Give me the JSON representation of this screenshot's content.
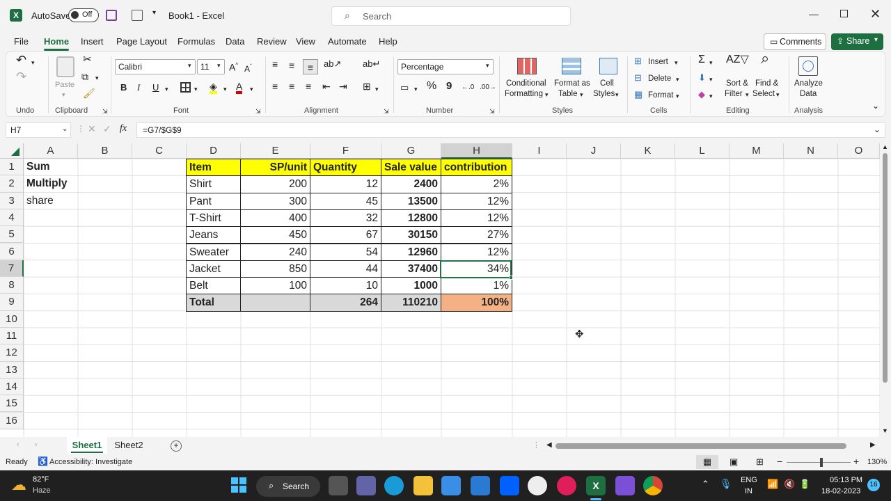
{
  "titlebar": {
    "autosave_label": "AutoSave",
    "autosave_state": "Off",
    "doc_title": "Book1  -  Excel",
    "search_placeholder": "Search"
  },
  "menu": {
    "tabs": [
      "File",
      "Home",
      "Insert",
      "Page Layout",
      "Formulas",
      "Data",
      "Review",
      "View",
      "Automate",
      "Help"
    ],
    "active_tab": "Home",
    "comments_label": "Comments",
    "share_label": "Share"
  },
  "ribbon": {
    "groups": {
      "undo": "Undo",
      "clipboard": "Clipboard",
      "font": "Font",
      "alignment": "Alignment",
      "number": "Number",
      "styles": "Styles",
      "cells": "Cells",
      "editing": "Editing",
      "analysis": "Analysis"
    },
    "paste_label": "Paste",
    "font_name": "Calibri",
    "font_size": "11",
    "number_format": "Percentage",
    "conditional_formatting": [
      "Conditional",
      "Formatting"
    ],
    "format_as_table": [
      "Format as",
      "Table"
    ],
    "cell_styles": [
      "Cell",
      "Styles"
    ],
    "insert_label": "Insert",
    "delete_label": "Delete",
    "format_label": "Format",
    "sort_filter": [
      "Sort &",
      "Filter"
    ],
    "find_select": [
      "Find &",
      "Select"
    ],
    "analyze_data": [
      "Analyze",
      "Data"
    ],
    "bold": "B",
    "italic": "I",
    "underline": "U",
    "percent": "%",
    "comma": "9"
  },
  "formula": {
    "name_box": "H7",
    "fx": "fx",
    "content": "=G7/$G$9"
  },
  "grid": {
    "columns": [
      "A",
      "B",
      "C",
      "D",
      "E",
      "F",
      "G",
      "H",
      "I",
      "J",
      "K",
      "L",
      "M",
      "N",
      "O"
    ],
    "rows": [
      "1",
      "2",
      "3",
      "4",
      "5",
      "6",
      "7",
      "8",
      "9",
      "10",
      "11",
      "12",
      "13",
      "14",
      "15",
      "16"
    ],
    "col_a": [
      "Sum",
      "Multiply",
      "share"
    ],
    "headers": [
      "Item",
      "SP/unit",
      "Quantity",
      "Sale value",
      "contribution"
    ],
    "data": [
      [
        "Shirt",
        "200",
        "12",
        "2400",
        "2%"
      ],
      [
        "Pant",
        "300",
        "45",
        "13500",
        "12%"
      ],
      [
        "T-Shirt",
        "400",
        "32",
        "12800",
        "12%"
      ],
      [
        "Jeans",
        "450",
        "67",
        "30150",
        "27%"
      ],
      [
        "Sweater",
        "240",
        "54",
        "12960",
        "12%"
      ],
      [
        "Jacket",
        "850",
        "44",
        "37400",
        "34%"
      ],
      [
        "Belt",
        "100",
        "10",
        "1000",
        "1%"
      ]
    ],
    "total": [
      "Total",
      "",
      "264",
      "110210",
      "100%"
    ],
    "colors": {
      "header_fill": "#ffff00",
      "total_fill": "#d9d9d9",
      "total_pct_fill": "#f4b183",
      "selection": "#217346"
    }
  },
  "sheets": {
    "tabs": [
      "Sheet1",
      "Sheet2"
    ],
    "active": "Sheet1"
  },
  "status": {
    "ready": "Ready",
    "accessibility": "Accessibility: Investigate",
    "zoom": "130%"
  },
  "taskbar": {
    "temp": "82°F",
    "weather": "Haze",
    "search": "Search",
    "lang1": "ENG",
    "lang2": "IN",
    "time": "05:13 PM",
    "date": "18-02-2023",
    "badge": "16"
  }
}
